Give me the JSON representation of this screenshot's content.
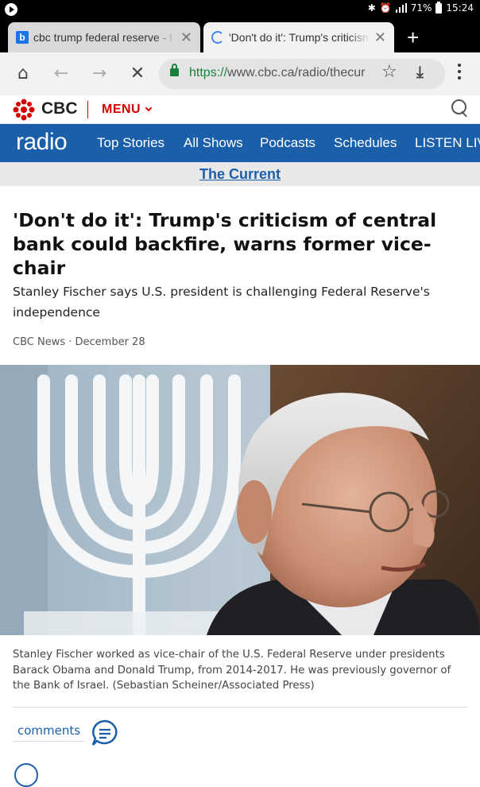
{
  "status_bar": {
    "battery": "71%",
    "time": "15:24"
  },
  "tabs": [
    {
      "title": "cbc trump federal reserve - I",
      "favicon": "bing-b-icon"
    },
    {
      "title": "'Don't do it': Trump's criticism",
      "favicon": "loading-spinner-icon"
    }
  ],
  "toolbar": {
    "url_scheme": "https://",
    "url_rest": "www.cbc.ca/radio/thecur"
  },
  "cbc_header": {
    "brand": "CBC",
    "menu_label": "MENU"
  },
  "radio_nav": {
    "logo": "radio",
    "links": [
      "Top Stories",
      "All Shows",
      "Podcasts",
      "Schedules",
      "LISTEN LIVE"
    ]
  },
  "show": {
    "name": "The Current"
  },
  "article": {
    "headline": "'Don't do it': Trump's criticism of central bank could backfire, warns former vice-chair",
    "deck": "Stanley Fischer says U.S. president is challenging Federal Reserve's independence",
    "byline": "CBC News · December 28",
    "caption": "Stanley Fischer worked as vice-chair of the U.S. Federal Reserve under presidents Barack Obama and Donald Trump, from 2014-2017. He was previously governor of the Bank of Israel. (Sebastian Scheiner/Associated Press)",
    "comments_label": "comments"
  },
  "colors": {
    "cbc_red": "#d40000",
    "radio_blue": "#1b5faa",
    "secure_green": "#188038"
  }
}
